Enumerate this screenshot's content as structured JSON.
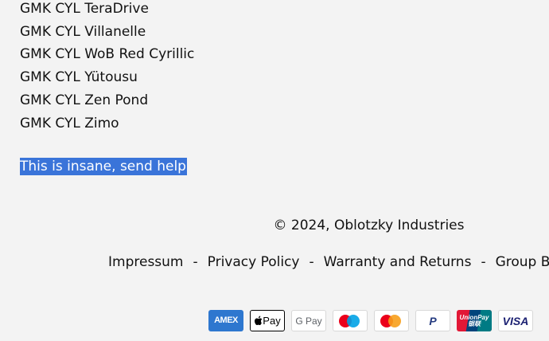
{
  "product_list": [
    "GMK CYL TeraDrive",
    "GMK CYL Villanelle",
    "GMK CYL WoB Red Cyrillic",
    "GMK CYL Yütousu",
    "GMK CYL Zen Pond",
    "GMK CYL Zimo"
  ],
  "note": "This is insane, send help",
  "footer": {
    "copyright": "© 2024, Oblotzky Industries",
    "links": [
      "Impressum",
      "Privacy Policy",
      "Warranty and Returns",
      "Group Buy"
    ],
    "separator": "-"
  },
  "payments": {
    "amex": "AMEX",
    "apple_pay": "Pay",
    "google_pay": "G Pay",
    "paypal": "P",
    "unionpay": "UnionPay",
    "unionpay_cn": "银联",
    "visa": "VISA"
  },
  "colors": {
    "selection": "#3a74d9",
    "background": "#f3f3f3"
  }
}
